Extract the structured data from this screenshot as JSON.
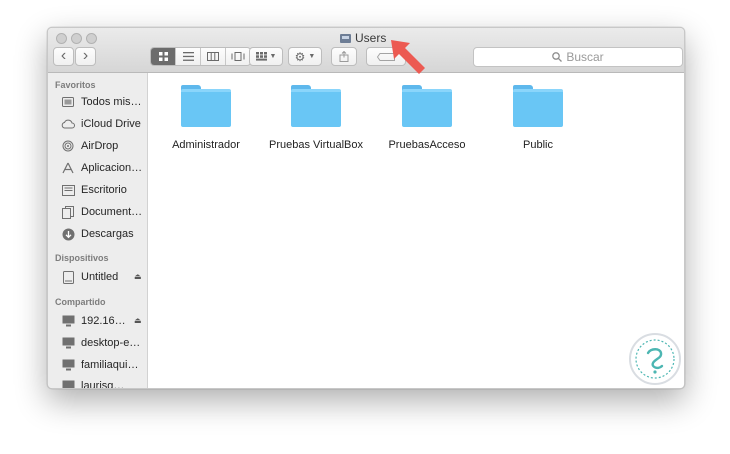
{
  "window": {
    "title": "Users"
  },
  "toolbar": {
    "back": "‹",
    "forward": "›",
    "search_placeholder": "Buscar",
    "colors": {
      "active_segment": "#6c6c6c",
      "arrow": "#ec5a52"
    }
  },
  "sidebar": {
    "sections": [
      {
        "title": "Favoritos",
        "items": [
          {
            "label": "Todos mis…",
            "icon": "all-files-icon"
          },
          {
            "label": "iCloud Drive",
            "icon": "cloud-icon"
          },
          {
            "label": "AirDrop",
            "icon": "airdrop-icon"
          },
          {
            "label": "Aplicacion…",
            "icon": "applications-icon"
          },
          {
            "label": "Escritorio",
            "icon": "desktop-icon"
          },
          {
            "label": "Document…",
            "icon": "documents-icon"
          },
          {
            "label": "Descargas",
            "icon": "downloads-icon"
          }
        ]
      },
      {
        "title": "Dispositivos",
        "items": [
          {
            "label": "Untitled",
            "icon": "disk-icon"
          }
        ]
      },
      {
        "title": "Compartido",
        "items": [
          {
            "label": "192.16…",
            "icon": "computer-icon"
          },
          {
            "label": "desktop-e…",
            "icon": "computer-icon"
          },
          {
            "label": "familiaqui…",
            "icon": "computer-icon"
          },
          {
            "label": "laurisg…",
            "icon": "computer-icon"
          }
        ]
      }
    ]
  },
  "folders": [
    {
      "name": "Administrador"
    },
    {
      "name": "Pruebas VirtualBox"
    },
    {
      "name": "PruebasAcceso"
    },
    {
      "name": "Public"
    }
  ],
  "colors": {
    "folder": "#69c6f5"
  }
}
